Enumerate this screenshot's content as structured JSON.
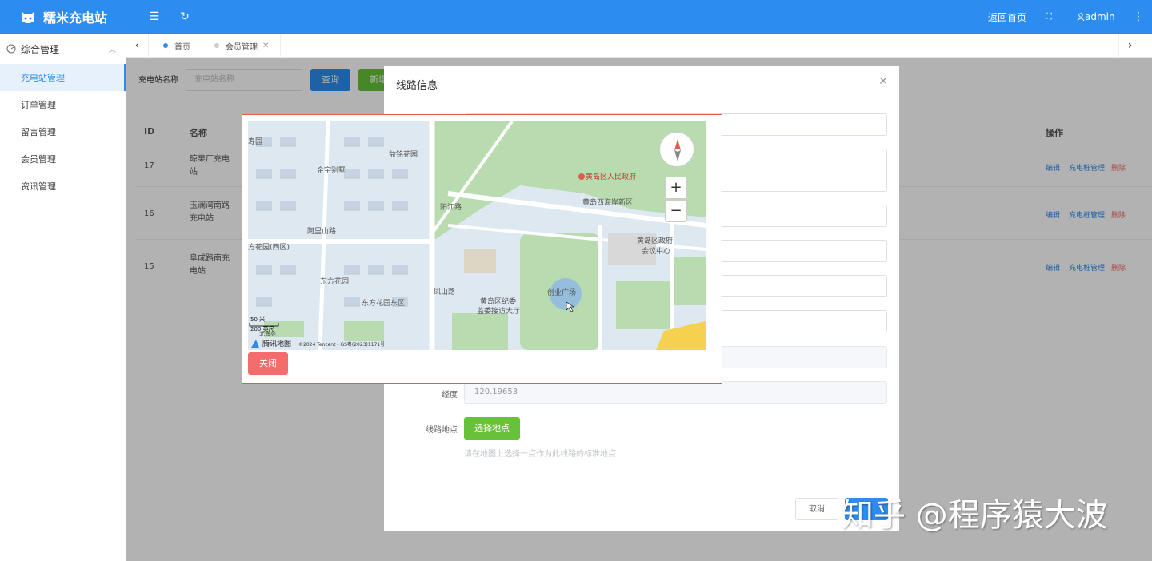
{
  "app": {
    "title": "糯米充电站"
  },
  "topbar": {
    "home_label": "返回首页",
    "user_label": "admin"
  },
  "sidebar": {
    "group_label": "综合管理",
    "items": [
      {
        "label": "充电站管理"
      },
      {
        "label": "订单管理"
      },
      {
        "label": "留言管理"
      },
      {
        "label": "会员管理"
      },
      {
        "label": "资讯管理"
      }
    ]
  },
  "tabs": [
    {
      "label": "首页"
    },
    {
      "label": "会员管理"
    }
  ],
  "search": {
    "label": "充电站名称",
    "placeholder": "充电站名称",
    "query_label": "查询",
    "add_label": "新增"
  },
  "table": {
    "headers": {
      "id": "ID",
      "name": "名称",
      "ops": "操作"
    },
    "rows": [
      {
        "id": "17",
        "name": "晾果厂充电站"
      },
      {
        "id": "16",
        "name": "玉澜湾南路充电站"
      },
      {
        "id": "15",
        "name": "阜成路南充电站"
      }
    ],
    "ops": {
      "edit": "编辑",
      "pile": "充电桩管理",
      "delete": "删除"
    }
  },
  "dialog": {
    "title": "线路信息",
    "longitude_label": "经度",
    "longitude_value": "120.19653",
    "location_label": "线路地点",
    "select_location_label": "选择地点",
    "hint": "请在地图上选择一点作为此线路的标准地点",
    "cancel_label": "取消"
  },
  "map": {
    "close_label": "关闭",
    "brand": "腾讯地图",
    "copyright": "©2024 Tencent - GS粤(2023)1171号",
    "scale_top": "50 米",
    "scale_bottom": "200 英尺",
    "labels": {
      "gov": "黄岛区人民政府",
      "west_coast": "黄岛西海岸新区",
      "council1": "黄岛区政府",
      "council2": "会议中心",
      "plaza": "创业广场",
      "jiwei1": "黄岛区纪委",
      "jiwei2": "监委接访大厅",
      "jinyu": "金宇别墅",
      "yiming": "益铭花园",
      "dongfang": "东方花园",
      "dongfang_west": "方花园(西区)",
      "dongfang_east": "东方花园东区",
      "yangjiang": "阳江路",
      "aling": "阿里山路",
      "fengshan": "凤山路",
      "beihai": "北海苑",
      "shouyuan": "寿园"
    }
  },
  "watermark": "知乎 @程序猿大波",
  "colors": {
    "primary": "#2d8cf0",
    "success": "#67c23a",
    "danger": "#f56c6c"
  }
}
